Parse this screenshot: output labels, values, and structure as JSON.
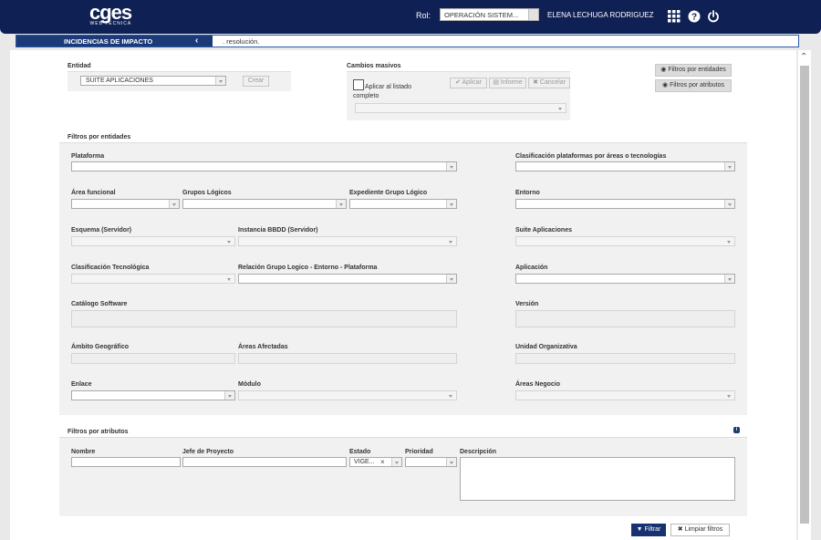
{
  "header": {
    "logo_word": "cges",
    "logo_sub": "WEB TECNICA",
    "rol_label": "Rol:",
    "rol_value": "OPERACIÓN SISTEM...",
    "user_name": "ELENA LECHUGA RODRIGUEZ"
  },
  "banner": {
    "title": "INCIDENCIAS DE IMPACTO",
    "text": ". resolución."
  },
  "entidad": {
    "label": "Entidad",
    "value": "SUITE APLICACIONES",
    "crear_label": "Crear"
  },
  "cambios": {
    "label": "Cambios masivos",
    "checkbox_label_1": "Aplicar al listado",
    "checkbox_label_2": "completo",
    "aplicar_label": "Aplicar",
    "informe_label": "Informe",
    "cancelar_label": "Cancelar"
  },
  "side_buttons": {
    "filtros_entidades": "Filtros por entidades",
    "filtros_atributos": "Filtros por atributos"
  },
  "filtros_entidades": {
    "section_title": "Filtros por entidades",
    "plataforma": "Plataforma",
    "clasificacion_plataformas": "Clasificación plataformas por áreas o tecnologías",
    "area_funcional": "Área funcional",
    "grupos_logicos": "Grupos Lógicos",
    "expediente_grupo_logico": "Expediente Grupo Lógico",
    "entorno": "Entorno",
    "esquema": "Esquema (Servidor)",
    "instancia_bbdd": "Instancia BBDD (Servidor)",
    "suite_aplicaciones": "Suite Aplicaciones",
    "clasificacion_tecnologica": "Clasificación Tecnológica",
    "relacion_grupo": "Relación Grupo Logico - Entorno - Plataforma",
    "aplicacion": "Aplicación",
    "catalogo_software": "Catálogo Software",
    "version": "Versión",
    "ambito_geografico": "Ámbito Geográfico",
    "areas_afectadas": "Áreas Afectadas",
    "unidad_organizativa": "Unidad Organizativa",
    "enlace": "Enlace",
    "modulo": "Módulo",
    "areas_negocio": "Áreas Negocio"
  },
  "filtros_atributos": {
    "section_title": "Filtros por atributos",
    "nombre": "Nombre",
    "jefe_proyecto": "Jefe de Proyecto",
    "estado": "Estado",
    "estado_value": "VIGE...",
    "prioridad": "Prioridad",
    "descripcion": "Descripción"
  },
  "actions": {
    "filtrar": "Filtrar",
    "limpiar": "Limpiar filtros"
  },
  "colors": {
    "header_bg": "#0f2154",
    "banner_title_bg": "#1d3a78",
    "panel_grey": "#f1f1f1"
  }
}
